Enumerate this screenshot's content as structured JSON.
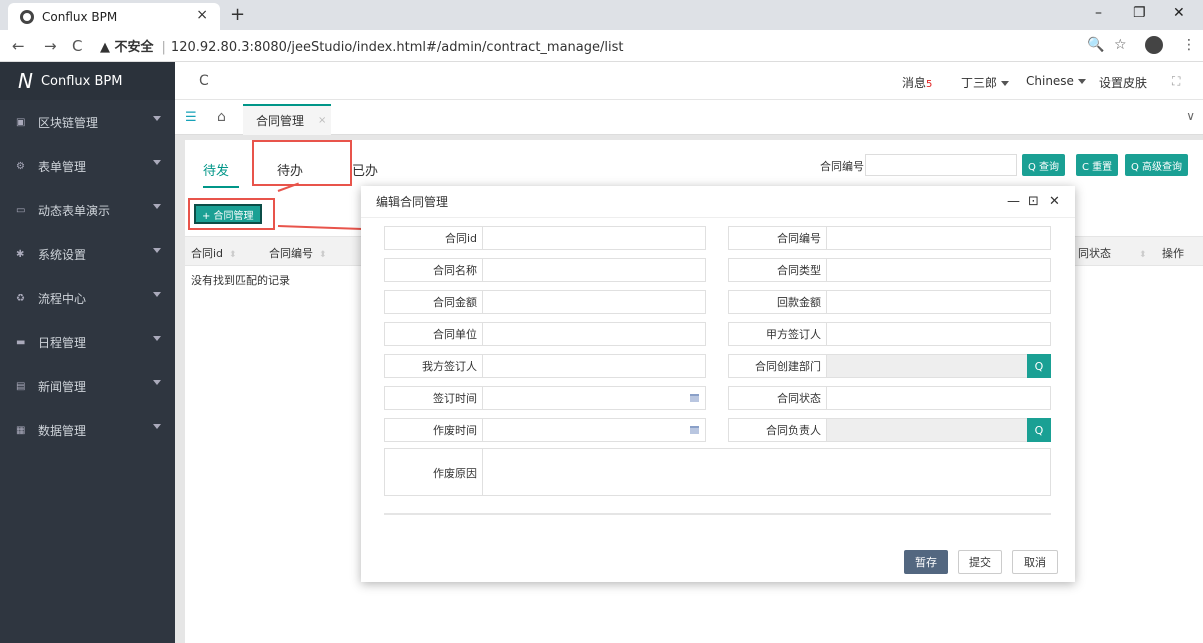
{
  "browser": {
    "tab_title": "Conflux BPM",
    "tab_close": "×",
    "new_tab": "+",
    "minimize": "–",
    "restore": "❐",
    "close": "✕",
    "back": "←",
    "forward": "→",
    "reload": "C",
    "security": "▲ 不安全",
    "url": "120.92.80.3:8080/jeeStudio/index.html#/admin/contract_manage/list",
    "zoom": "🔍",
    "star": "☆",
    "more": "⋮"
  },
  "sidebar": {
    "logo": "Conflux BPM",
    "items": [
      {
        "label": "区块链管理",
        "icon": "▣"
      },
      {
        "label": "表单管理",
        "icon": "⚙"
      },
      {
        "label": "动态表单演示",
        "icon": "▭"
      },
      {
        "label": "系统设置",
        "icon": "✱"
      },
      {
        "label": "流程中心",
        "icon": "♻"
      },
      {
        "label": "日程管理",
        "icon": "▬"
      },
      {
        "label": "新闻管理",
        "icon": "▤"
      },
      {
        "label": "数据管理",
        "icon": "▦"
      }
    ]
  },
  "topbar": {
    "refresh": "C",
    "messages": "消息",
    "message_count": "5",
    "user": "丁三郎",
    "language": "Chinese",
    "skin": "设置皮肤",
    "fullscreen": "⛶"
  },
  "tabstrip": {
    "menu_icon": "☰",
    "home_icon": "⌂",
    "active_tab": "合同管理",
    "tab_close": "×",
    "chevron": "∨"
  },
  "content": {
    "subtabs": [
      "待发",
      "待办",
      "已办"
    ],
    "query_label": "合同编号",
    "query_value": "",
    "buttons": {
      "search": "Q 查询",
      "reset": "C 重置",
      "advanced": "Q 高级查询"
    },
    "add_button": "+ 合同管理",
    "columns": [
      "合同id",
      "合同编号",
      "同状态",
      "操作"
    ],
    "sort_glyph": "⬍",
    "empty_text": "没有找到匹配的记录"
  },
  "modal": {
    "title": "编辑合同管理",
    "min": "—",
    "max": "⊡",
    "close": "✕",
    "fields": {
      "contract_id": "合同id",
      "contract_no": "合同编号",
      "contract_name": "合同名称",
      "contract_type": "合同类型",
      "contract_amount": "合同金额",
      "refund_amount": "回款金额",
      "contract_unit": "合同单位",
      "party_a_signer": "甲方签订人",
      "our_signer": "我方签订人",
      "create_dept": "合同创建部门",
      "sign_time": "签订时间",
      "contract_status": "合同状态",
      "void_time": "作废时间",
      "owner": "合同负责人",
      "void_reason": "作废原因"
    },
    "search_icon": "Q",
    "buttons": {
      "save": "暂存",
      "submit": "提交",
      "cancel": "取消"
    }
  }
}
